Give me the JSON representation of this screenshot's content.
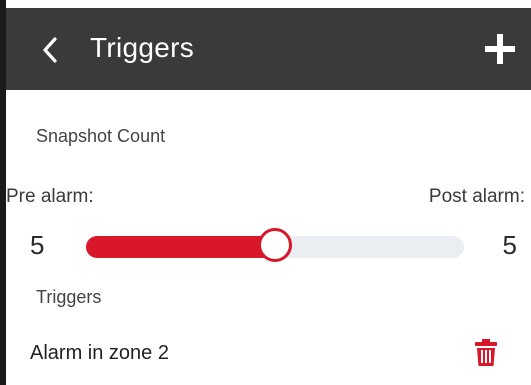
{
  "header": {
    "title": "Triggers",
    "back_icon": "chevron-left-icon",
    "add_icon": "plus-icon",
    "background_color": "#3a3a3a"
  },
  "snapshot": {
    "section_label": "Snapshot Count",
    "pre_label": "Pre alarm:",
    "post_label": "Post alarm:",
    "pre_value": "5",
    "post_value": "5",
    "slider_fraction": 0.5,
    "accent_color": "#d8172b"
  },
  "triggers": {
    "section_label": "Triggers",
    "items": [
      {
        "name": "Alarm in zone 2",
        "delete_icon": "trash-icon"
      }
    ]
  }
}
